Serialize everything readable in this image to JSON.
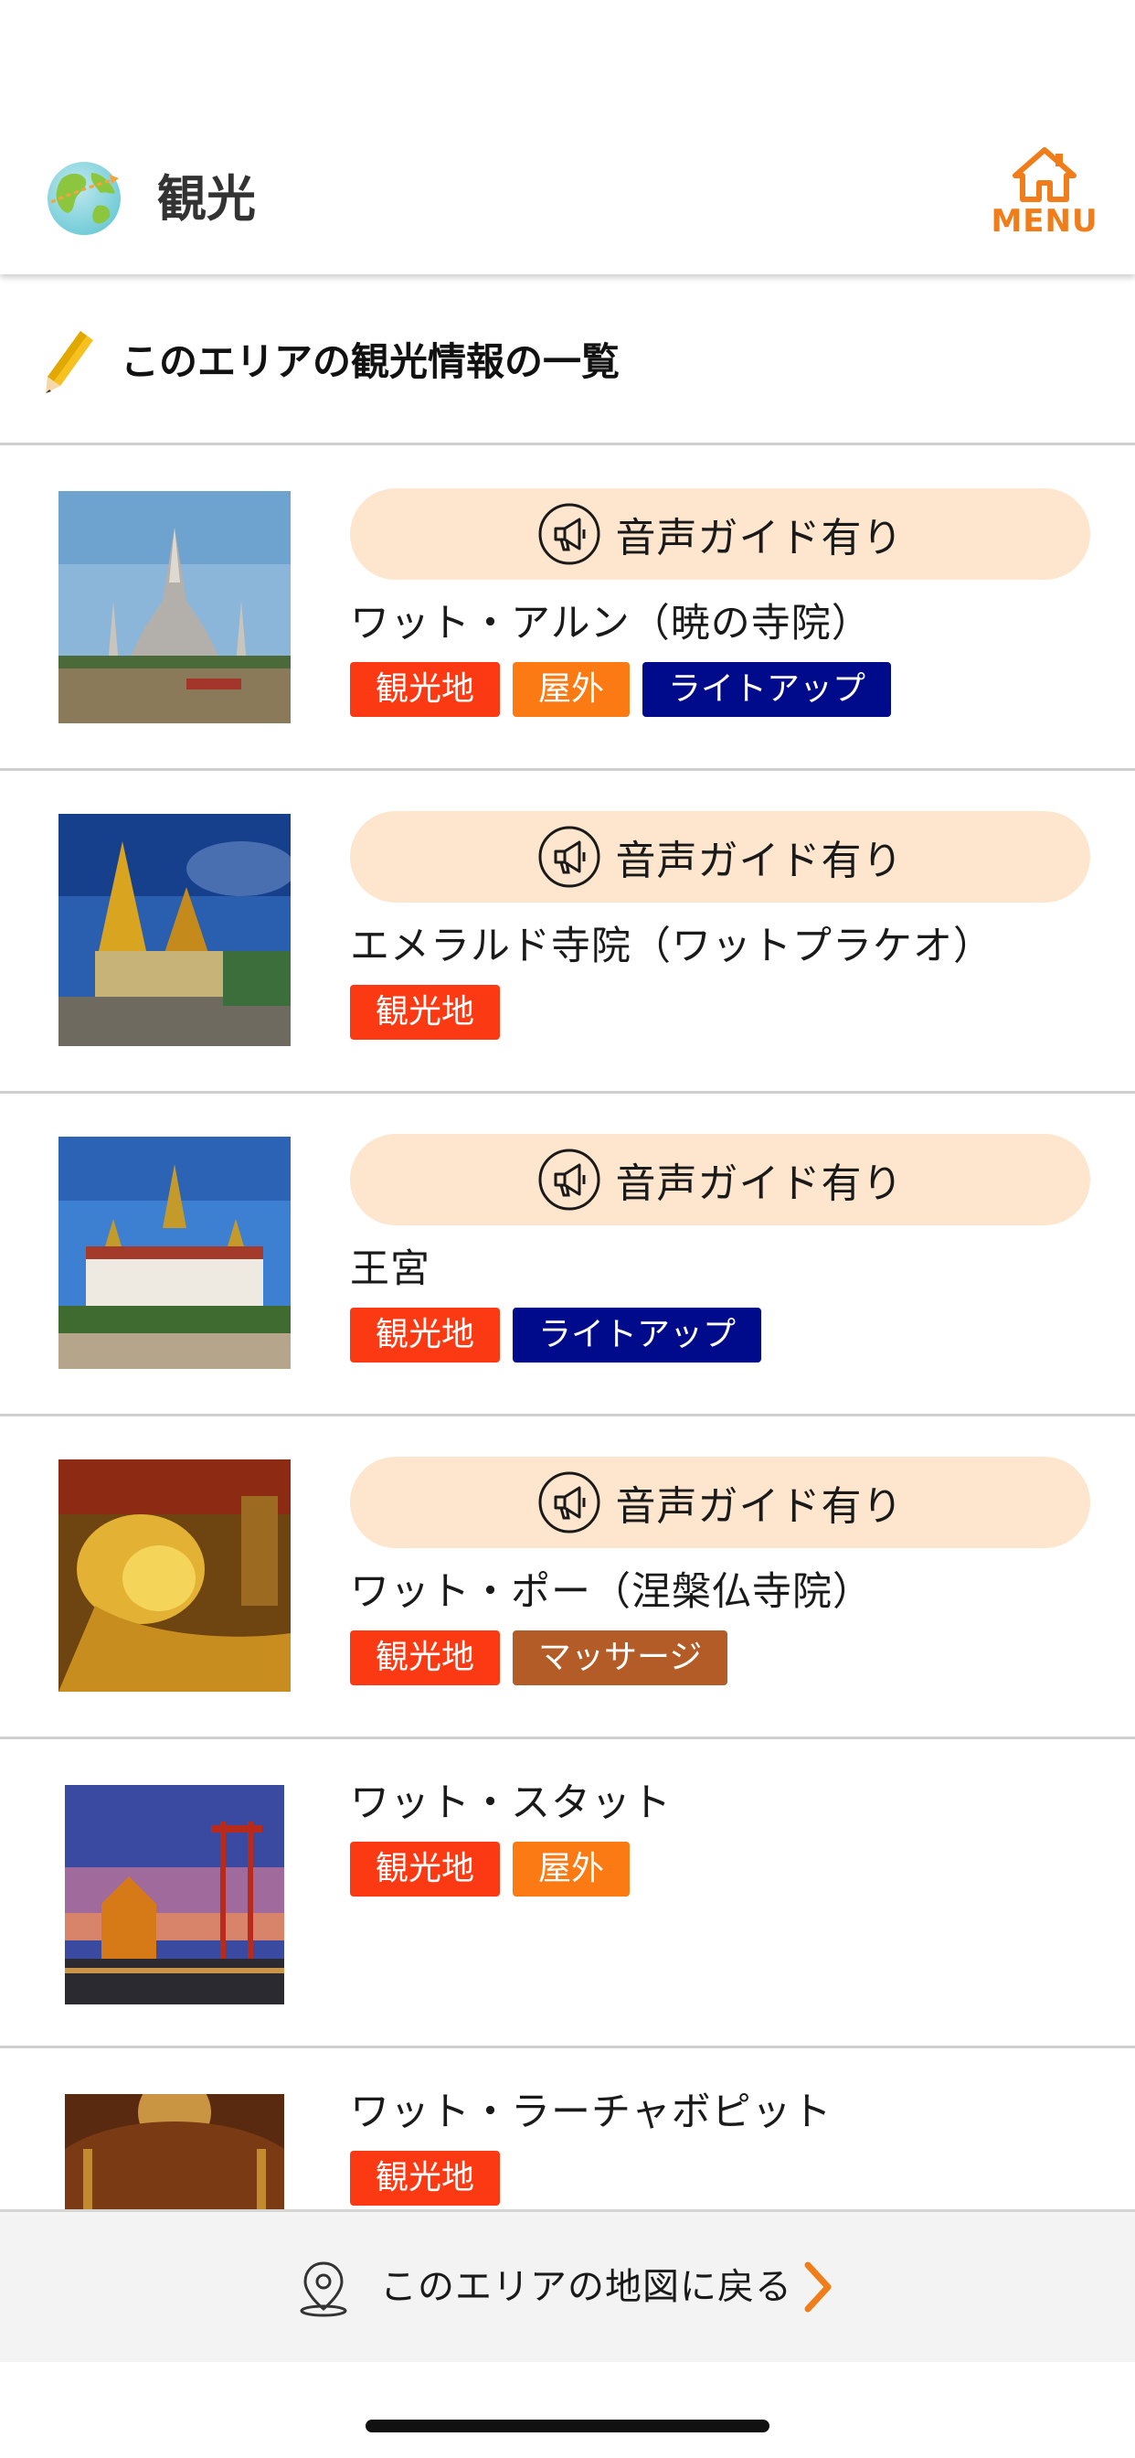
{
  "header": {
    "title": "観光",
    "menu_label": "MENU",
    "accent_color": "#f07d1a"
  },
  "section": {
    "title": "このエリアの観光情報の一覧"
  },
  "list": {
    "audio_guide_label": "音声ガイド有り",
    "items": [
      {
        "name": "ワット・アルン（暁の寺院）",
        "audio_guide": true,
        "tags": [
          {
            "label": "観光地",
            "color": "#fb3a14"
          },
          {
            "label": "屋外",
            "color": "#fb7a14"
          },
          {
            "label": "ライトアップ",
            "color": "#000b8c"
          }
        ]
      },
      {
        "name": "エメラルド寺院（ワットプラケオ）",
        "audio_guide": true,
        "tags": [
          {
            "label": "観光地",
            "color": "#fb3a14"
          }
        ]
      },
      {
        "name": "王宮",
        "audio_guide": true,
        "tags": [
          {
            "label": "観光地",
            "color": "#fb3a14"
          },
          {
            "label": "ライトアップ",
            "color": "#000b8c"
          }
        ]
      },
      {
        "name": "ワット・ポー（涅槃仏寺院）",
        "audio_guide": true,
        "tags": [
          {
            "label": "観光地",
            "color": "#fb3a14"
          },
          {
            "label": "マッサージ",
            "color": "#b35c28"
          }
        ]
      },
      {
        "name": "ワット・スタット",
        "audio_guide": false,
        "tags": [
          {
            "label": "観光地",
            "color": "#fb3a14"
          },
          {
            "label": "屋外",
            "color": "#fb7a14"
          }
        ]
      },
      {
        "name": "ワット・ラーチャボピット",
        "audio_guide": false,
        "tags": [
          {
            "label": "観光地",
            "color": "#fb3a14"
          }
        ]
      }
    ]
  },
  "footer": {
    "label": "このエリアの地図に戻る",
    "chevron_color": "#f07d1a"
  }
}
